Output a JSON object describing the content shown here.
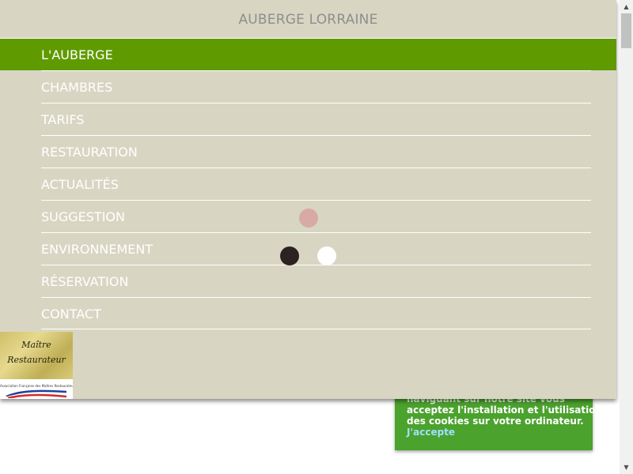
{
  "site": {
    "title": "AUBERGE LORRAINE"
  },
  "nav": {
    "items": [
      {
        "label": "L'AUBERGE",
        "active": true
      },
      {
        "label": "CHAMBRES",
        "active": false
      },
      {
        "label": "TARIFS",
        "active": false
      },
      {
        "label": "RESTAURATION",
        "active": false
      },
      {
        "label": "ACTUALITÉS",
        "active": false
      },
      {
        "label": "SUGGESTION",
        "active": false
      },
      {
        "label": "ENVIRONNEMENT",
        "active": false
      },
      {
        "label": "RÉSERVATION",
        "active": false
      },
      {
        "label": "CONTACT",
        "active": false
      }
    ]
  },
  "cookie": {
    "line1": "naviguant sur notre site vous",
    "line2": "acceptez l'installation et l'utilisation",
    "line3": "des cookies sur votre ordinateur.",
    "accept_label": "J'accepte"
  },
  "badge": {
    "line1": "Maître",
    "line2": "Restaurateur",
    "association": "Association Française des Maîtres Restaurateurs"
  },
  "scrollbar": {
    "up_icon": "▲",
    "down_icon": "▼"
  },
  "colors": {
    "menu_background": "#d8d6c2",
    "active_item": "#5f9a00",
    "cookie_banner": "#4ba22d",
    "title_text": "#8e8e8e"
  }
}
